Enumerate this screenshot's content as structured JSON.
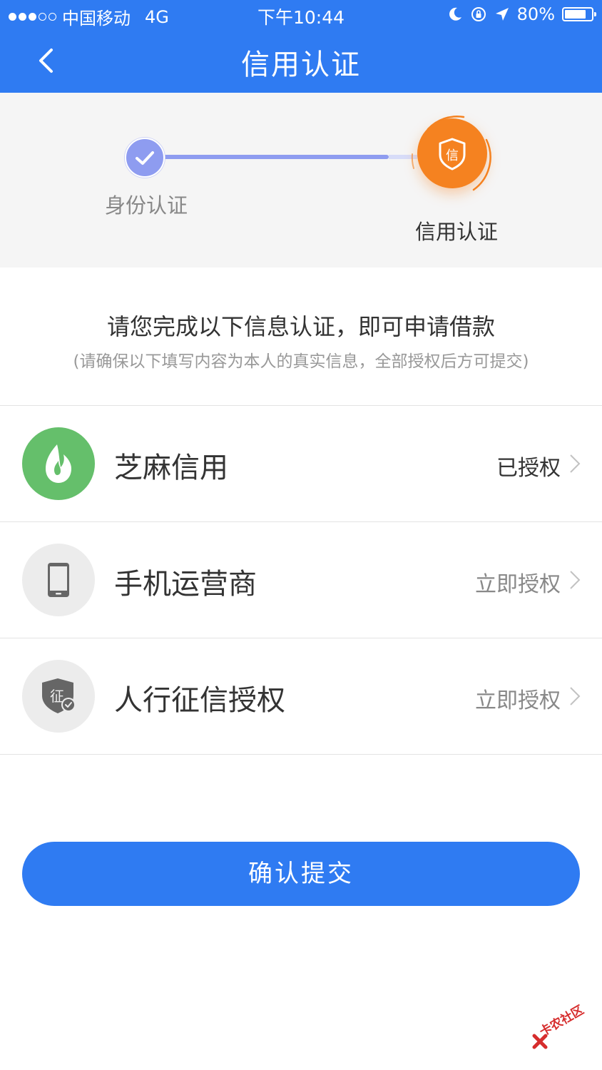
{
  "status_bar": {
    "carrier": "中国移动",
    "network": "4G",
    "time": "下午10:44",
    "battery": "80%",
    "battery_level": 0.8,
    "signal_strength": 3
  },
  "nav": {
    "title": "信用认证",
    "back_icon": "chevron-left-icon"
  },
  "steps": [
    {
      "label": "身份认证",
      "state": "done",
      "icon": "check-icon",
      "color": "#8e9cf0"
    },
    {
      "label": "信用认证",
      "state": "active",
      "icon": "shield-icon",
      "icon_text": "信",
      "color": "#f58220"
    }
  ],
  "intro": {
    "title": "请您完成以下信息认证，即可申请借款",
    "note": "(请确保以下填写内容为本人的真实信息，全部授权后方可提交)"
  },
  "items": [
    {
      "name": "芝麻信用",
      "status": "已授权",
      "icon": "sesame-drop-icon",
      "icon_color": "#65bf6b"
    },
    {
      "name": "手机运营商",
      "status": "立即授权",
      "icon": "phone-icon",
      "icon_color": "#ececec"
    },
    {
      "name": "人行征信授权",
      "status": "立即授权",
      "icon": "credit-shield-icon",
      "icon_text": "征",
      "icon_color": "#ececec"
    }
  ],
  "submit_label": "确认提交",
  "watermark": "卡农社区",
  "colors": {
    "primary": "#2f7bf2",
    "accent": "#f58220",
    "step_done": "#8e9cf0",
    "page_bg": "#f5f5f5"
  }
}
